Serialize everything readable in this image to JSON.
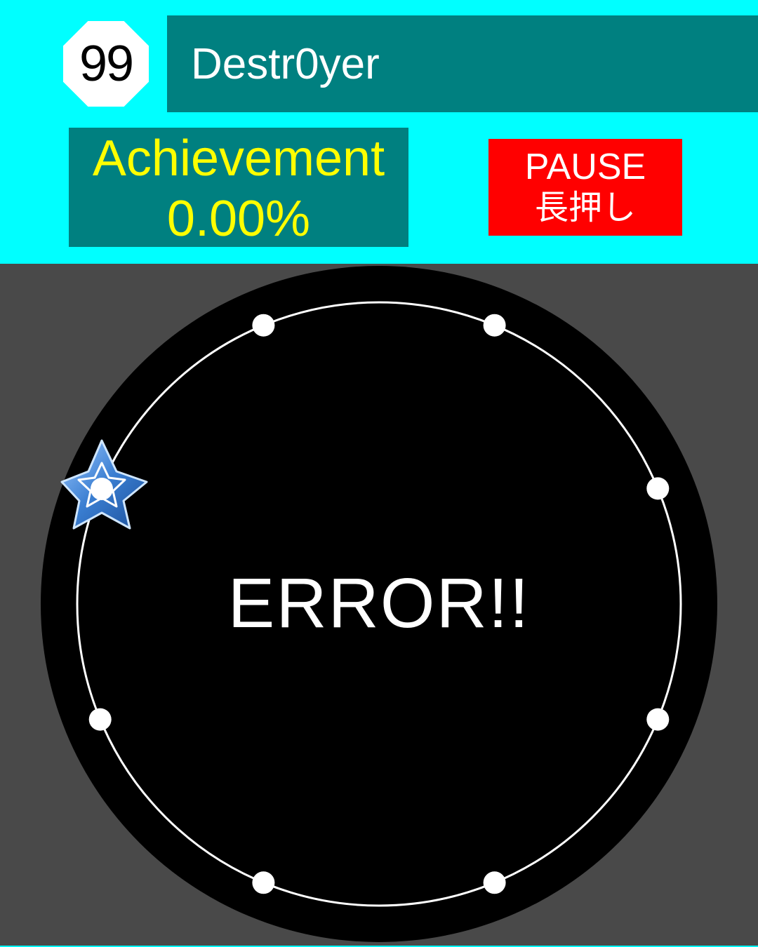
{
  "header": {
    "level": "99",
    "song_title": "Destr0yer",
    "achievement_label": "Achievement",
    "achievement_value": "0.00%",
    "pause_label": "PAUSE",
    "pause_hint": "長押し"
  },
  "playfield": {
    "status_text": "ERROR!!",
    "buttons": [
      {
        "name": "button-1"
      },
      {
        "name": "button-2"
      },
      {
        "name": "button-3"
      },
      {
        "name": "button-4"
      },
      {
        "name": "button-5"
      },
      {
        "name": "button-6"
      },
      {
        "name": "button-7"
      },
      {
        "name": "button-8"
      }
    ],
    "notes": [
      {
        "type": "star",
        "lane": 8,
        "icon": "star-icon"
      }
    ]
  },
  "colors": {
    "header_bg": "#00ffff",
    "panel": "#008080",
    "achievement_text": "#ffff00",
    "pause_bg": "#ff0000",
    "field_bg": "#494949",
    "ring": "#000000",
    "star": "#3a7ed1"
  }
}
